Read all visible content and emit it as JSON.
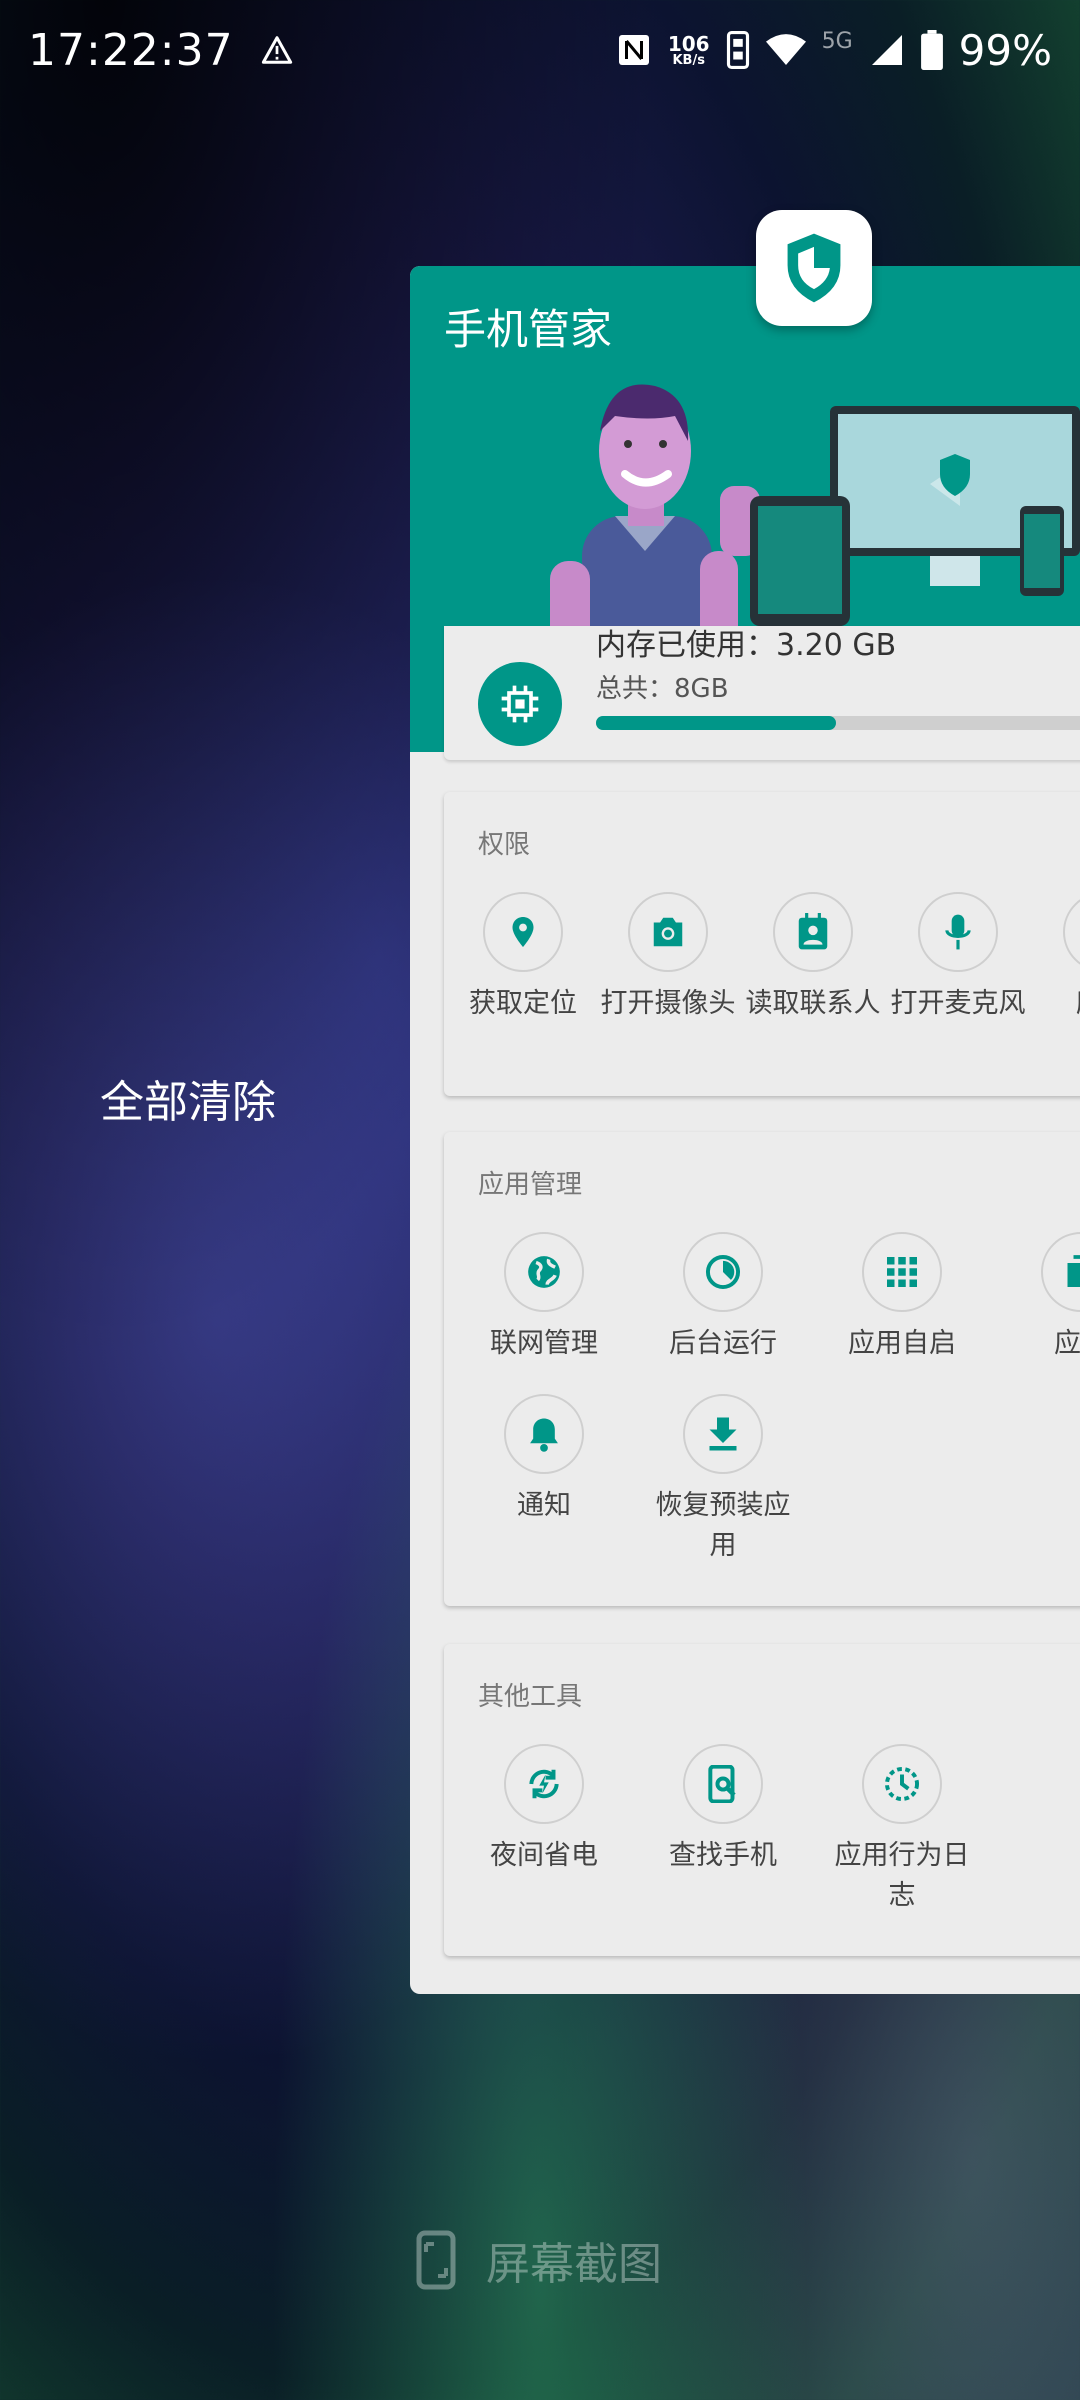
{
  "status": {
    "time": "17:22:37",
    "net_speed": "106",
    "net_unit": "KB/s",
    "network": "5G",
    "battery": "99%"
  },
  "recents": {
    "clear_all": "全部清除",
    "screenshot": "屏幕截图"
  },
  "app": {
    "title": "手机管家",
    "memory": {
      "used_label": "内存已使用：3.20 GB",
      "total_label": "总共：8GB",
      "usage_fraction": 0.4
    },
    "permissions": {
      "title": "权限",
      "items": [
        {
          "label": "获取定位",
          "icon": "location-pin-icon"
        },
        {
          "label": "打开摄像头",
          "icon": "camera-icon"
        },
        {
          "label": "读取联系人",
          "icon": "contacts-icon"
        },
        {
          "label": "打开麦克风",
          "icon": "microphone-icon"
        },
        {
          "label": "所有",
          "icon": "more-icon"
        }
      ]
    },
    "app_management": {
      "title": "应用管理",
      "items": [
        {
          "label": "联网管理",
          "icon": "globe-icon"
        },
        {
          "label": "后台运行",
          "icon": "pie-timer-icon"
        },
        {
          "label": "应用自启",
          "icon": "grid-apps-icon"
        },
        {
          "label": "应用",
          "icon": "copy-apps-icon"
        },
        {
          "label": "通知",
          "icon": "bell-icon"
        },
        {
          "label": "恢复预装应用",
          "icon": "download-icon"
        }
      ]
    },
    "other_tools": {
      "title": "其他工具",
      "items": [
        {
          "label": "夜间省电",
          "icon": "battery-saver-icon"
        },
        {
          "label": "查找手机",
          "icon": "find-phone-icon"
        },
        {
          "label": "应用行为日志",
          "icon": "activity-log-icon"
        }
      ]
    }
  },
  "colors": {
    "accent": "#009688",
    "card_bg": "#ececec"
  }
}
